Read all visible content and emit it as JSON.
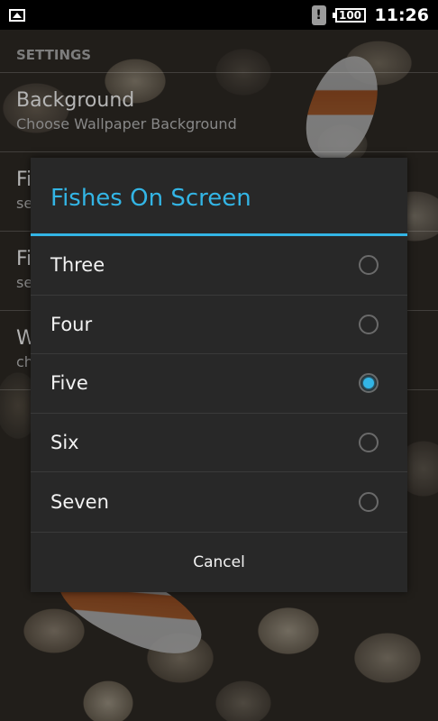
{
  "status_bar": {
    "battery": "100",
    "time": "11:26",
    "icons": [
      "image-icon",
      "alert-icon",
      "battery-icon"
    ]
  },
  "settings": {
    "header": "SETTINGS",
    "items": [
      {
        "title": "Background",
        "subtitle": "Choose Wallpaper Background"
      },
      {
        "title": "Fi",
        "subtitle": "se"
      },
      {
        "title": "Fi",
        "subtitle": "se"
      },
      {
        "title": "W",
        "subtitle": "ch"
      }
    ]
  },
  "dialog": {
    "title": "Fishes On Screen",
    "options": [
      {
        "label": "Three",
        "selected": false
      },
      {
        "label": "Four",
        "selected": false
      },
      {
        "label": "Five",
        "selected": true
      },
      {
        "label": "Six",
        "selected": false
      },
      {
        "label": "Seven",
        "selected": false
      }
    ],
    "cancel_label": "Cancel"
  },
  "colors": {
    "accent": "#33b5e5",
    "dialog_bg": "#282828",
    "status_bar_bg": "#000000"
  }
}
